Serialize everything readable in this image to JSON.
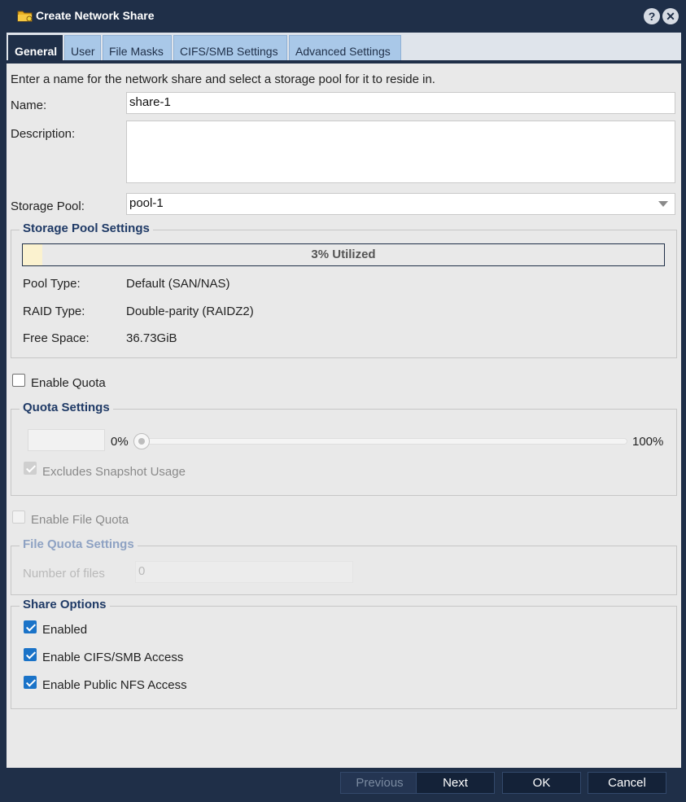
{
  "window": {
    "title": "Create Network Share",
    "icon": "share-folder-icon",
    "help_icon": "?",
    "close_icon": "✕"
  },
  "tabs": [
    {
      "label": "General",
      "active": true
    },
    {
      "label": "User",
      "active": false
    },
    {
      "label": "File Masks",
      "active": false
    },
    {
      "label": "CIFS/SMB Settings",
      "active": false
    },
    {
      "label": "Advanced Settings",
      "active": false
    }
  ],
  "general": {
    "intro": "Enter a name for the network share and select a storage pool for it to reside in.",
    "name_label": "Name:",
    "name_value": "share-1",
    "description_label": "Description:",
    "description_value": "",
    "storage_pool_label": "Storage Pool:",
    "storage_pool_value": "pool-1"
  },
  "storage_pool_settings": {
    "legend": "Storage Pool Settings",
    "utilization_text": "3% Utilized",
    "utilization_fraction": 0.03,
    "pool_type_label": "Pool Type:",
    "pool_type_value": "Default (SAN/NAS)",
    "raid_type_label": "RAID Type:",
    "raid_type_value": "Double-parity (RAIDZ2)",
    "free_space_label": "Free Space:",
    "free_space_value": "36.73GiB"
  },
  "quota": {
    "enable_label": "Enable Quota",
    "enable_checked": false,
    "legend": "Quota Settings",
    "min_label": "0%",
    "max_label": "100%",
    "slider_value": 0,
    "excludes_snapshot_label": "Excludes Snapshot Usage",
    "excludes_snapshot_checked": true
  },
  "file_quota": {
    "enable_label": "Enable File Quota",
    "enable_checked": false,
    "legend": "File Quota Settings",
    "number_of_files_label": "Number of files",
    "number_of_files_value": "0"
  },
  "share_options": {
    "legend": "Share Options",
    "enabled_label": "Enabled",
    "enabled_checked": true,
    "cifs_label": "Enable CIFS/SMB Access",
    "cifs_checked": true,
    "nfs_label": "Enable Public NFS Access",
    "nfs_checked": true
  },
  "footer": {
    "previous": "Previous",
    "next": "Next",
    "ok": "OK",
    "cancel": "Cancel"
  },
  "colors": {
    "titlebar": "#1f2f48",
    "tab_inactive": "#a9c8e8",
    "checkbox_checked": "#1a73c8",
    "legend_text": "#1f3a66",
    "utilization_fill": "#fbf2cf"
  }
}
